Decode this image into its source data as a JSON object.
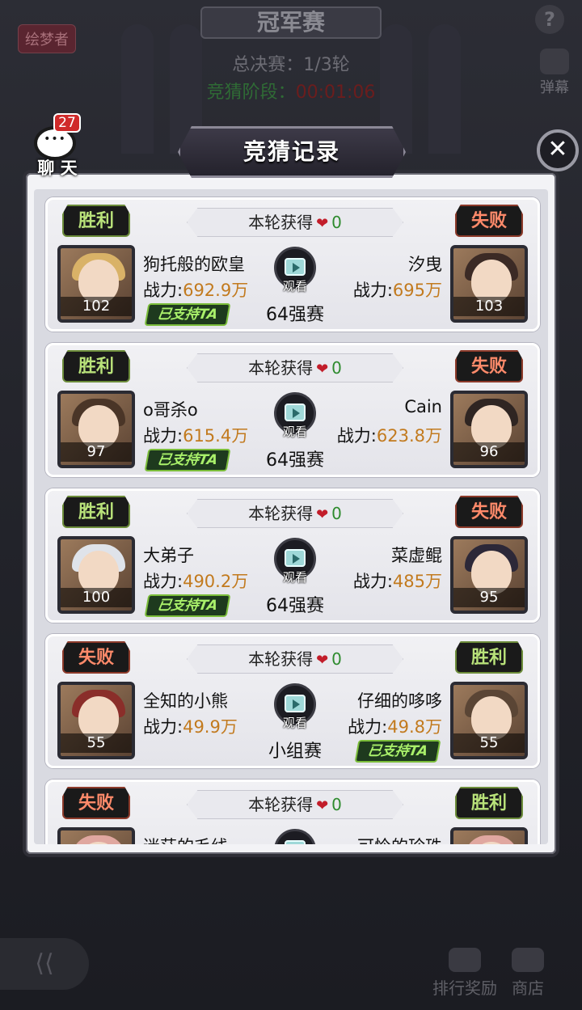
{
  "background": {
    "title": "冠军赛",
    "round_text": "总决赛：1/3轮",
    "phase_label": "竞猜阶段：",
    "phase_timer": "00:01:06",
    "tag": "绘梦者",
    "help_icon": "?",
    "danmu_label": "弹幕",
    "rank_reward_label": "排行奖励",
    "shop_label": "商店"
  },
  "chat": {
    "label": "聊 天",
    "badge": "27"
  },
  "panel": {
    "title": "竞猜记录",
    "close_icon": "✕"
  },
  "records": [
    {
      "reward_label": "本轮获得",
      "reward_count": "0",
      "left": {
        "result": "胜利",
        "name": "狗托般的欧皇",
        "power_label": "战力:",
        "power": "692.9万",
        "level": "102",
        "supported": "已支持TA",
        "hair": "#d9b267"
      },
      "right": {
        "result": "失败",
        "name": "汐曳",
        "power_label": "战力:",
        "power": "695万",
        "level": "103",
        "supported": "",
        "hair": "#3b2a25"
      },
      "watch_label": "观看",
      "stage": "64强赛"
    },
    {
      "reward_label": "本轮获得",
      "reward_count": "0",
      "left": {
        "result": "胜利",
        "name": "o哥杀o",
        "power_label": "战力:",
        "power": "615.4万",
        "level": "97",
        "supported": "已支持TA",
        "hair": "#4a3527"
      },
      "right": {
        "result": "失败",
        "name": "Cain",
        "power_label": "战力:",
        "power": "623.8万",
        "level": "96",
        "supported": "",
        "hair": "#2f2522"
      },
      "watch_label": "观看",
      "stage": "64强赛"
    },
    {
      "reward_label": "本轮获得",
      "reward_count": "0",
      "left": {
        "result": "胜利",
        "name": "大弟子",
        "power_label": "战力:",
        "power": "490.2万",
        "level": "100",
        "supported": "已支持TA",
        "hair": "#dfe3ea"
      },
      "right": {
        "result": "失败",
        "name": "菜虚鲲",
        "power_label": "战力:",
        "power": "485万",
        "level": "95",
        "supported": "",
        "hair": "#2c2838"
      },
      "watch_label": "观看",
      "stage": "64强赛"
    },
    {
      "reward_label": "本轮获得",
      "reward_count": "0",
      "left": {
        "result": "失败",
        "name": "全知的小熊",
        "power_label": "战力:",
        "power": "49.9万",
        "level": "55",
        "supported": "",
        "hair": "#8a2e2a"
      },
      "right": {
        "result": "胜利",
        "name": "仔细的哆哆",
        "power_label": "战力:",
        "power": "49.8万",
        "level": "55",
        "supported": "已支持TA",
        "hair": "#5a4535"
      },
      "watch_label": "观看",
      "stage": "小组赛"
    },
    {
      "reward_label": "本轮获得",
      "reward_count": "0",
      "left": {
        "result": "失败",
        "name": "迷茫的毛线",
        "power_label": "",
        "power": "",
        "level": "",
        "supported": "",
        "hair": "#e0a7a0"
      },
      "right": {
        "result": "胜利",
        "name": "可怜的珍珠",
        "power_label": "",
        "power": "",
        "level": "",
        "supported": "",
        "hair": "#e0a7a0"
      },
      "watch_label": "",
      "stage": ""
    }
  ]
}
